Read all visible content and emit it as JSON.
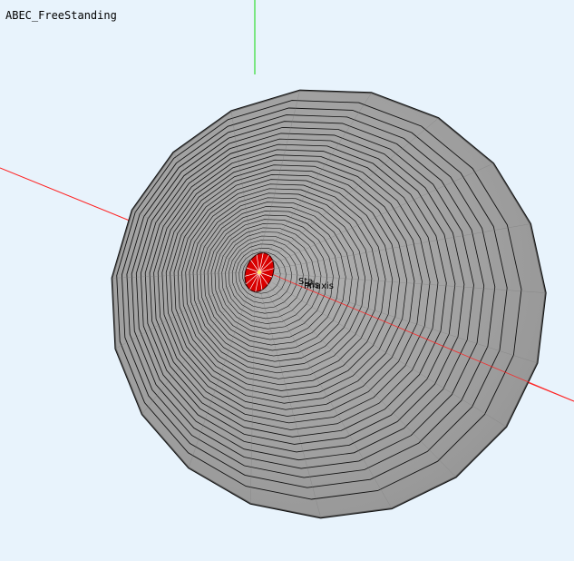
{
  "window": {
    "title": "ABEC_FreeStanding"
  },
  "axes": {
    "labels": [
      "Sta",
      "xis",
      "Pr-axis"
    ]
  },
  "colors": {
    "background": "#e8f3fc",
    "x_axis": "#ff2020",
    "y_axis": "#33dd33",
    "horn_fill": "#9e9e9e",
    "horn_edge": "#111111",
    "throat": "#d80000"
  }
}
